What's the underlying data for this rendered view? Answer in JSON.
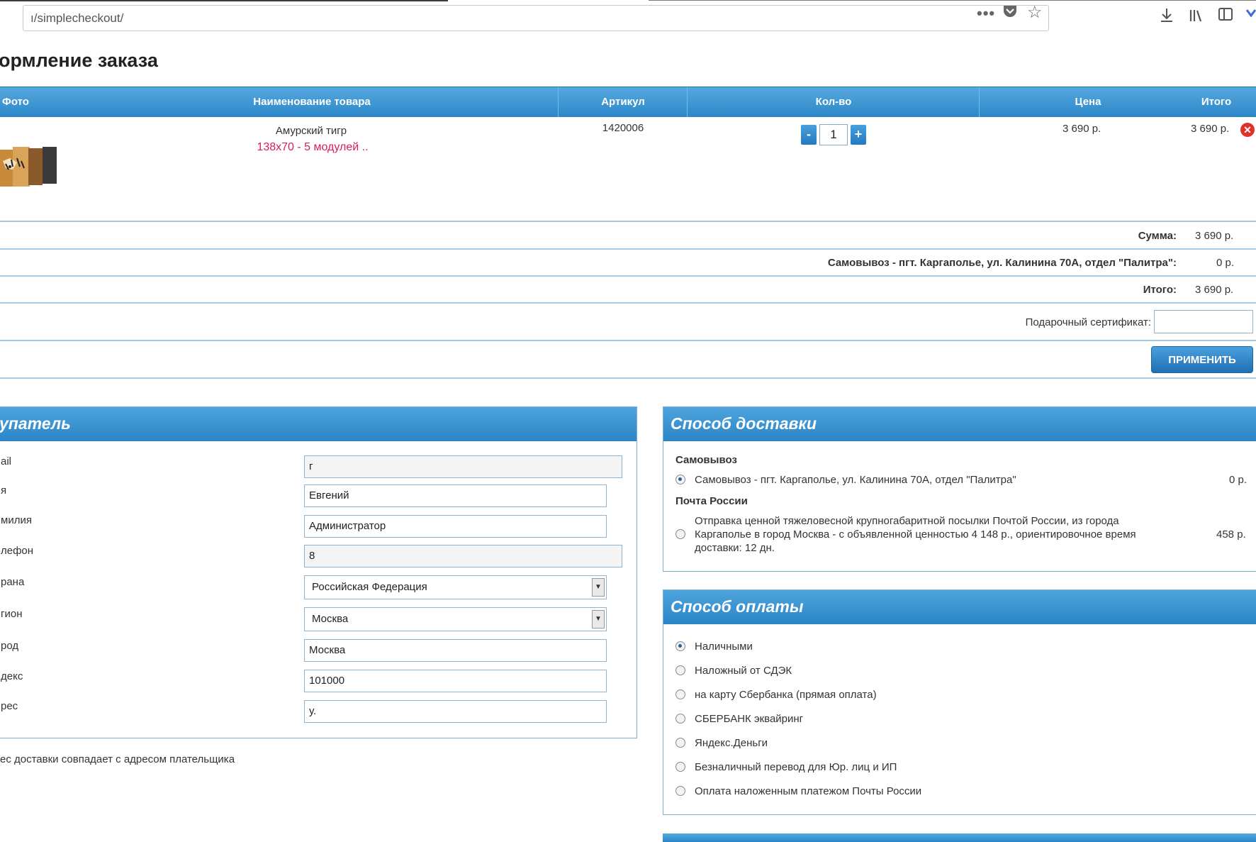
{
  "browser": {
    "url": "ı/simplecheckout/",
    "icons": [
      "more-dots-icon",
      "pocket-icon",
      "bookmark-star-icon",
      "download-icon",
      "library-icon",
      "sidebar-icon",
      "extension-icon"
    ]
  },
  "page_title": "ормление заказа",
  "cart": {
    "headers": {
      "photo": "Фото",
      "name": "Наименование товара",
      "sku": "Артикул",
      "qty": "Кол-во",
      "price": "Цена",
      "total": "Итого"
    },
    "item": {
      "name": "Амурский тигр",
      "options": "138x70 - 5 модулей ..",
      "sku": "1420006",
      "qty": "1",
      "qty_minus": "-",
      "qty_plus": "+",
      "price": "3 690 р.",
      "total": "3 690 р.",
      "remove": "✕"
    },
    "summary": {
      "sum_label": "Сумма:",
      "sum_value": "3 690 р.",
      "shipping_label": "Самовывоз - пгт. Каргаполье, ул. Калинина 70А, отдел \"Палитра\":",
      "shipping_value": "0 р.",
      "total_label": "Итого:",
      "total_value": "3 690 р."
    },
    "gift": {
      "label": "Подарочный сертификат:",
      "value": "",
      "apply_button": "ПРИМЕНИТЬ"
    }
  },
  "buyer": {
    "title": "упатель",
    "fields": {
      "email": {
        "label": "ail",
        "value": "г"
      },
      "name": {
        "label": "я",
        "value": "Евгений"
      },
      "surname": {
        "label": "милия",
        "value": "Администратор"
      },
      "phone": {
        "label": "лефон",
        "value": "8"
      },
      "country": {
        "label": "рана",
        "value": "Российская Федерация"
      },
      "region": {
        "label": "гион",
        "value": "Москва"
      },
      "city": {
        "label": "род",
        "value": "Москва"
      },
      "zip": {
        "label": "декс",
        "value": "101000"
      },
      "address": {
        "label": "рес",
        "value": "у."
      }
    },
    "same_address": "ес доставки совпадает с адресом плательщика"
  },
  "delivery": {
    "title": "Способ доставки",
    "group1": "Самовывоз",
    "option1": {
      "text": "Самовывоз - пгт. Каргаполье, ул. Калинина 70А, отдел \"Палитра\"",
      "price": "0 р.",
      "selected": true
    },
    "group2": "Почта России",
    "option2": {
      "line1": "Отправка ценной тяжеловесной крупногабаритной посылки Почтой России, из города",
      "line2": "Каргаполье в город Москва - с объявленной ценностью 4 148 р., ориентировочное время",
      "line3": "доставки: 12 дн.",
      "price": "458 р.",
      "selected": false
    }
  },
  "payment": {
    "title": "Способ оплаты",
    "options": [
      {
        "text": "Наличными",
        "selected": true
      },
      {
        "text": "Наложный от СДЭК",
        "selected": false
      },
      {
        "text": "на карту Сбербанка (прямая оплата)",
        "selected": false
      },
      {
        "text": "СБЕРБАНК эквайринг",
        "selected": false
      },
      {
        "text": "Яндекс.Деньги",
        "selected": false
      },
      {
        "text": "Безналичный перевод для Юр. лиц и ИП",
        "selected": false
      },
      {
        "text": "Оплата наложенным платежом Почты России",
        "selected": false
      }
    ]
  },
  "colors": {
    "header_blue": "#2c87c8",
    "accent_red": "#d81e52",
    "border_blue": "#7ab0d6"
  }
}
